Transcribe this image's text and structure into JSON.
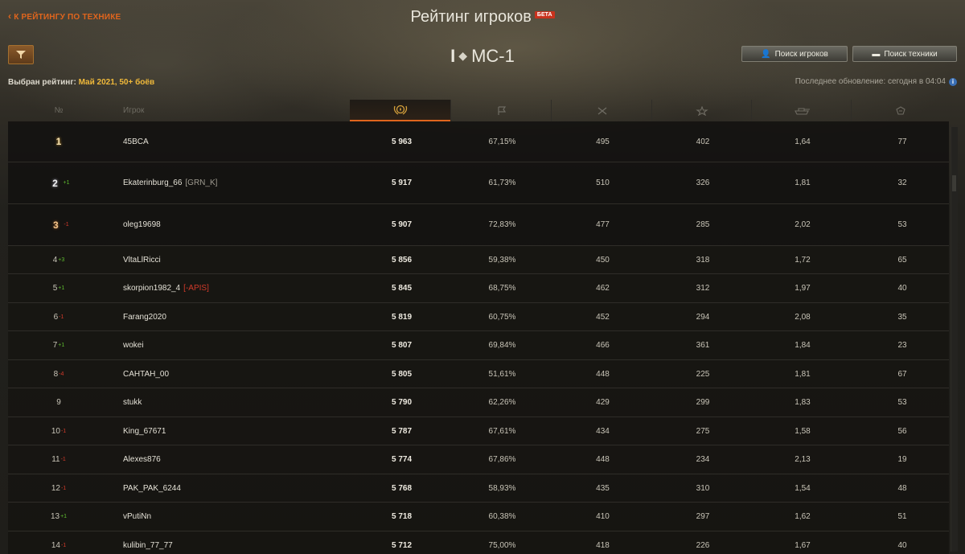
{
  "header": {
    "back_label": "К РЕЙТИНГУ ПО ТЕХНИКЕ",
    "title": "Рейтинг игроков",
    "beta_badge": "БЕТА",
    "vehicle_tier": "I",
    "vehicle_name": "МС-1",
    "search_players_label": "Поиск игроков",
    "search_vehicles_label": "Поиск техники",
    "selected_rating_label": "Выбран рейтинг:",
    "selected_rating_value": "Май 2021, 50+ боёв",
    "last_update": "Последнее обновление: сегодня в 04:04"
  },
  "table": {
    "columns": {
      "rank": "№",
      "player": "Игрок"
    },
    "column_icons": [
      "laurel-wreath-icon",
      "flag-icon",
      "crossed-swords-icon",
      "star-xp-icon",
      "tank-icon",
      "shield-icon"
    ],
    "rows": [
      {
        "rank": "1",
        "medal": "1",
        "change": "",
        "player": "45BCA",
        "clan": "",
        "score": "5 963",
        "win": "67,15%",
        "battles": "495",
        "xp": "402",
        "ratio": "1,64",
        "dmg": "77"
      },
      {
        "rank": "2",
        "medal": "2",
        "change": "+1",
        "player": "Ekaterinburg_66",
        "clan": "[GRN_K]",
        "score": "5 917",
        "win": "61,73%",
        "battles": "510",
        "xp": "326",
        "ratio": "1,81",
        "dmg": "32"
      },
      {
        "rank": "3",
        "medal": "3",
        "change": "-1",
        "player": "oleg19698",
        "clan": "",
        "score": "5 907",
        "win": "72,83%",
        "battles": "477",
        "xp": "285",
        "ratio": "2,02",
        "dmg": "53"
      },
      {
        "rank": "4",
        "change": "+3",
        "player": "VltaLlRicci",
        "clan": "",
        "score": "5 856",
        "win": "59,38%",
        "battles": "450",
        "xp": "318",
        "ratio": "1,72",
        "dmg": "65"
      },
      {
        "rank": "5",
        "change": "+1",
        "player": "skorpion1982_4",
        "clan": "[-APIS]",
        "clan_color": "red",
        "score": "5 845",
        "win": "68,75%",
        "battles": "462",
        "xp": "312",
        "ratio": "1,97",
        "dmg": "40"
      },
      {
        "rank": "6",
        "change": "-1",
        "player": "Farang2020",
        "clan": "",
        "score": "5 819",
        "win": "60,75%",
        "battles": "452",
        "xp": "294",
        "ratio": "2,08",
        "dmg": "35"
      },
      {
        "rank": "7",
        "change": "+1",
        "player": "wokei",
        "clan": "",
        "score": "5 807",
        "win": "69,84%",
        "battles": "466",
        "xp": "361",
        "ratio": "1,84",
        "dmg": "23"
      },
      {
        "rank": "8",
        "change": "-4",
        "player": "CAHTAH_00",
        "clan": "",
        "score": "5 805",
        "win": "51,61%",
        "battles": "448",
        "xp": "225",
        "ratio": "1,81",
        "dmg": "67"
      },
      {
        "rank": "9",
        "change": "",
        "player": "stukk",
        "clan": "",
        "score": "5 790",
        "win": "62,26%",
        "battles": "429",
        "xp": "299",
        "ratio": "1,83",
        "dmg": "53"
      },
      {
        "rank": "10",
        "change": "-1",
        "player": "King_67671",
        "clan": "",
        "score": "5 787",
        "win": "67,61%",
        "battles": "434",
        "xp": "275",
        "ratio": "1,58",
        "dmg": "56"
      },
      {
        "rank": "11",
        "change": "-1",
        "player": "Alexes876",
        "clan": "",
        "score": "5 774",
        "win": "67,86%",
        "battles": "448",
        "xp": "234",
        "ratio": "2,13",
        "dmg": "19"
      },
      {
        "rank": "12",
        "change": "-1",
        "player": "PAK_PAK_6244",
        "clan": "",
        "score": "5 768",
        "win": "58,93%",
        "battles": "435",
        "xp": "310",
        "ratio": "1,54",
        "dmg": "48"
      },
      {
        "rank": "13",
        "change": "+1",
        "player": "vPutiNn",
        "clan": "",
        "score": "5 718",
        "win": "60,38%",
        "battles": "410",
        "xp": "297",
        "ratio": "1,62",
        "dmg": "51"
      },
      {
        "rank": "14",
        "change": "-1",
        "player": "kulibin_77_77",
        "clan": "",
        "score": "5 712",
        "win": "75,00%",
        "battles": "418",
        "xp": "226",
        "ratio": "1,67",
        "dmg": "40"
      }
    ]
  },
  "colors": {
    "accent": "#e0651d",
    "rating_value": "#f0b93a",
    "change_up": "#5fbd2f",
    "change_down": "#d23a2a"
  }
}
